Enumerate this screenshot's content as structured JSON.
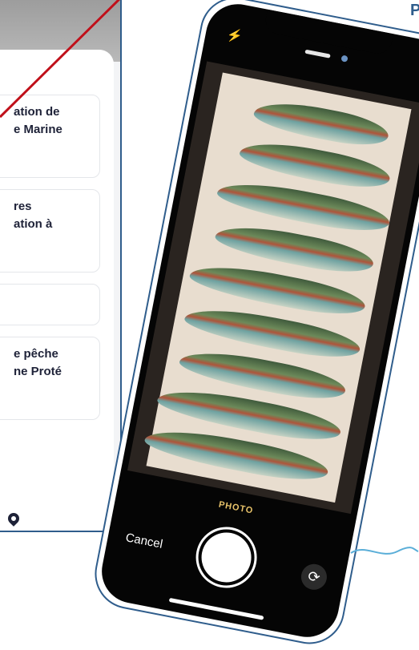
{
  "background_app": {
    "cards": [
      {
        "line1": "ation de",
        "line2": "e Marine"
      },
      {
        "line1": "res",
        "line2": "ation à"
      },
      {
        "line1": "",
        "line2": ""
      },
      {
        "line1": "e pêche",
        "line2": "ne Proté"
      }
    ],
    "icons": {
      "pin": "map-pin-icon"
    }
  },
  "camera": {
    "mode": "PHOTO",
    "cancel_label": "Cancel",
    "icons": {
      "flash": "flash-icon",
      "flip": "flip-camera-icon"
    }
  },
  "page": {
    "corner_letter": "P"
  },
  "colors": {
    "accent": "#2f5d8c",
    "annotation": "#c0101a",
    "mode": "#e8c36a"
  }
}
